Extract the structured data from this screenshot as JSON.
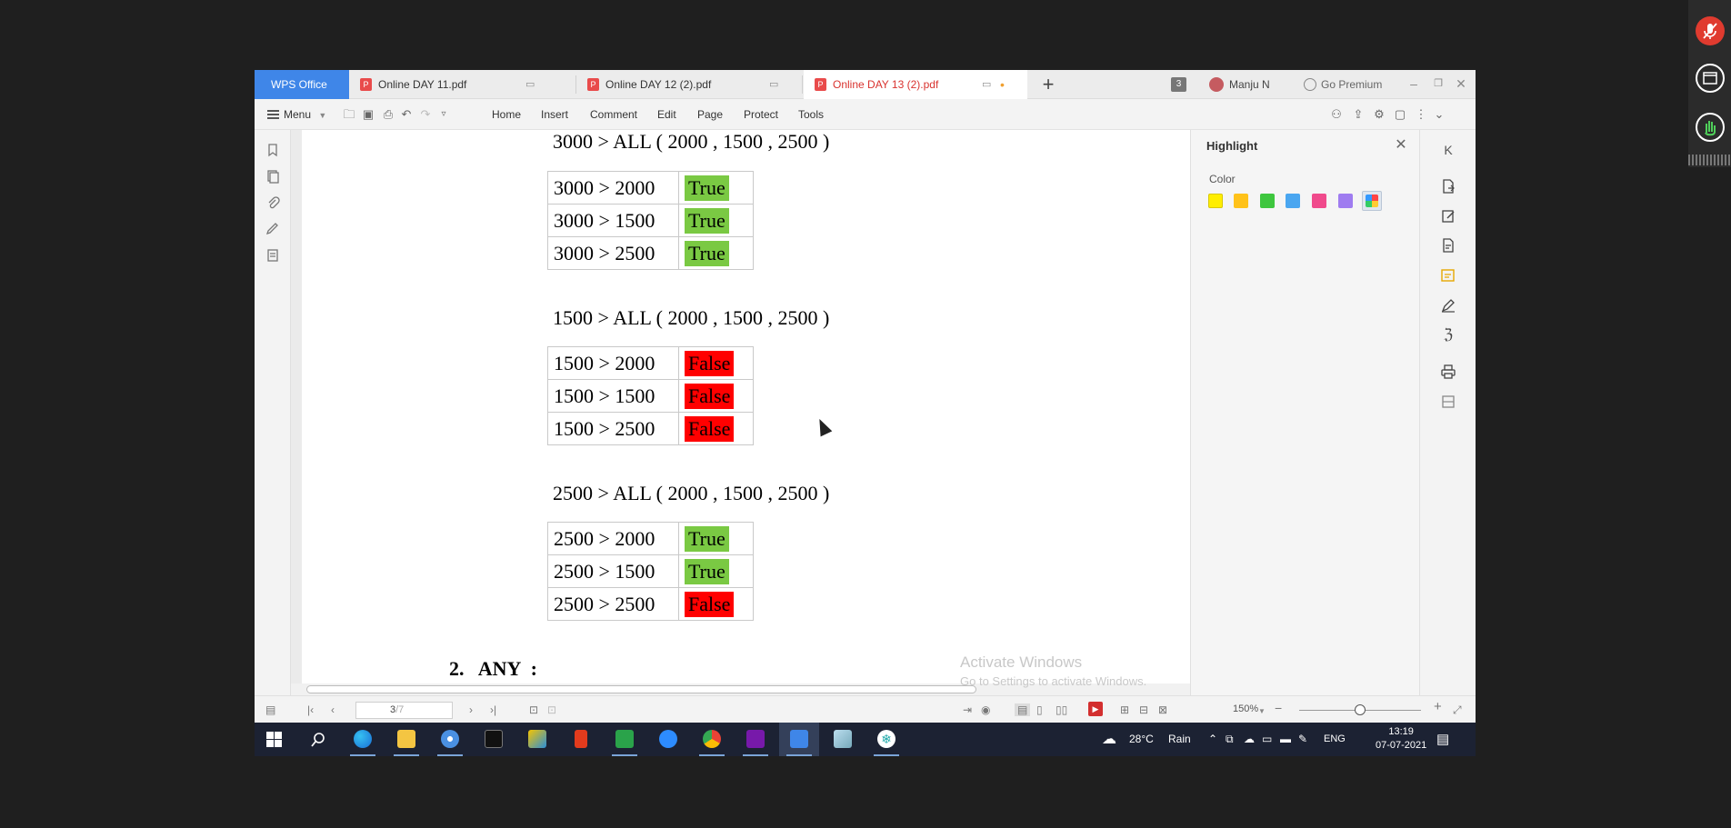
{
  "titlebar": {
    "wps_home": "WPS Office",
    "tabs": [
      {
        "label": "Online DAY 11.pdf",
        "active": false
      },
      {
        "label": "Online DAY 12 (2).pdf",
        "active": false
      },
      {
        "label": "Online DAY 13 (2).pdf",
        "active": true
      }
    ],
    "tab_count": "3",
    "user_name": "Manju N",
    "go_premium": "Go Premium"
  },
  "menubar": {
    "menu_label": "Menu",
    "tabs": [
      "Home",
      "Insert",
      "Comment",
      "Edit",
      "Page",
      "Protect",
      "Tools"
    ]
  },
  "document": {
    "blocks": [
      {
        "expression": "3000 > ALL ( 2000 , 1500 , 2500 )",
        "rows": [
          {
            "cmp": "3000 > 2000",
            "result": "True"
          },
          {
            "cmp": "3000 > 1500",
            "result": "True"
          },
          {
            "cmp": "3000 > 2500",
            "result": "True"
          }
        ]
      },
      {
        "expression": "1500 > ALL ( 2000 , 1500 , 2500 )",
        "rows": [
          {
            "cmp": "1500 > 2000",
            "result": "False"
          },
          {
            "cmp": "1500 > 1500",
            "result": "False"
          },
          {
            "cmp": "1500 > 2500",
            "result": "False"
          }
        ]
      },
      {
        "expression": "2500 > ALL ( 2000 , 1500 , 2500 )",
        "rows": [
          {
            "cmp": "2500 > 2000",
            "result": "True"
          },
          {
            "cmp": "2500 > 1500",
            "result": "True"
          },
          {
            "cmp": "2500 > 2500",
            "result": "False"
          }
        ]
      }
    ],
    "section_heading": "2.   ANY  :"
  },
  "highlight_panel": {
    "title": "Highlight",
    "color_label": "Color",
    "swatches": [
      "#ffee00",
      "#ffc21a",
      "#3ec63e",
      "#4aa6f0",
      "#f04a8c",
      "#9f7cf0",
      "multicolor"
    ]
  },
  "watermark": {
    "line1": "Activate Windows",
    "line2": "Go to Settings to activate Windows."
  },
  "statusbar": {
    "page_value": "3",
    "page_total": "/7",
    "zoom": "150%"
  },
  "taskbar": {
    "weather_temp": "28°C",
    "weather_desc": "Rain",
    "language": "ENG",
    "time": "13:19",
    "date": "07-07-2021"
  },
  "colors": {
    "true_bg": "#7ac943",
    "false_bg": "#ff0000",
    "wps_blue": "#3f86e8",
    "active_tab_text": "#d9332f"
  }
}
